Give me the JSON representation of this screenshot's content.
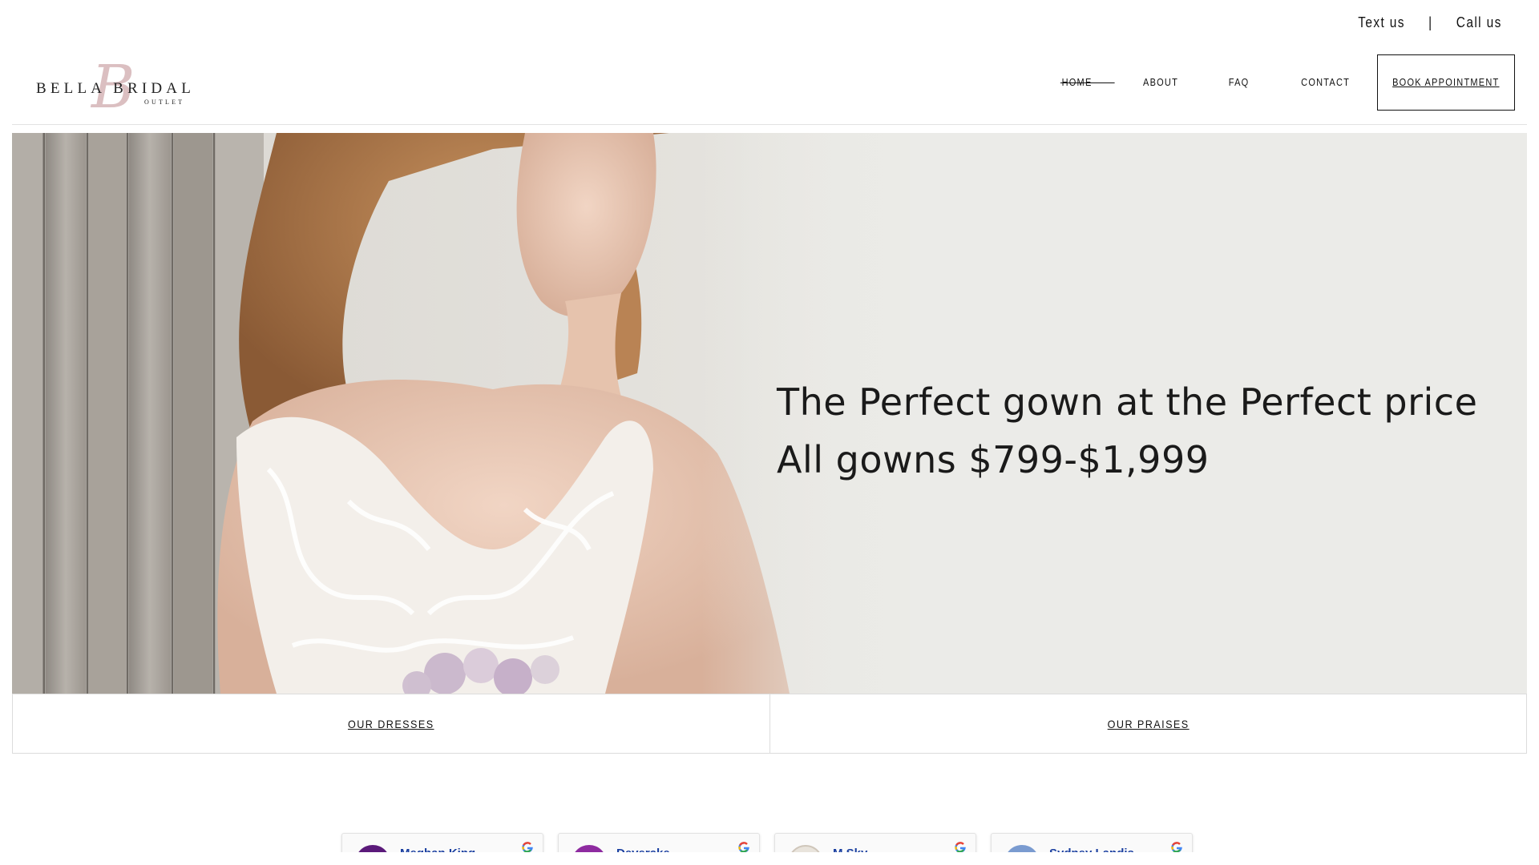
{
  "topbar": {
    "text_us": "Text us",
    "separator": "|",
    "call_us": "Call us"
  },
  "logo": {
    "brand": "BELLA BRIDAL",
    "sub": "OUTLET",
    "monogram": "B",
    "accent": "#c9a3a6"
  },
  "nav": {
    "items": [
      {
        "label": "HOME",
        "active": true
      },
      {
        "label": "ABOUT",
        "active": false
      },
      {
        "label": "FAQ",
        "active": false
      },
      {
        "label": "CONTACT",
        "active": false
      }
    ],
    "cta": "BOOK APPOINTMENT"
  },
  "hero": {
    "line1": "The Perfect gown at the Perfect price",
    "line2": "All gowns $799-$1,999"
  },
  "tabs": {
    "left": "OUR DRESSES",
    "right": "OUR PRAISES"
  },
  "reviews": [
    {
      "name": "Meghan King",
      "avatar_color": "#5b1a7a"
    },
    {
      "name": "Deverake",
      "avatar_color": "#8e2ba0"
    },
    {
      "name": "M Sky",
      "avatar_color": "#d9d2c8"
    },
    {
      "name": "Sydney Landis",
      "avatar_color": "#7a9bd0"
    }
  ]
}
